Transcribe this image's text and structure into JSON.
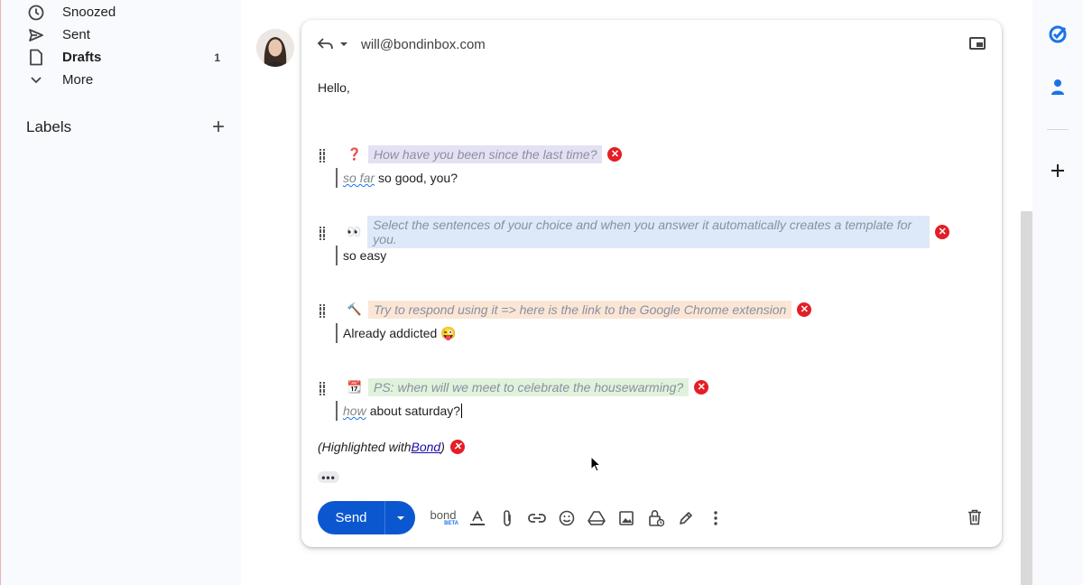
{
  "sidebar": {
    "items": [
      {
        "label": "Snoozed",
        "icon": "clock-icon",
        "count": ""
      },
      {
        "label": "Sent",
        "icon": "send-icon",
        "count": ""
      },
      {
        "label": "Drafts",
        "icon": "draft-icon",
        "count": "1"
      },
      {
        "label": "More",
        "icon": "chevron-down-icon",
        "count": ""
      }
    ],
    "labels_heading": "Labels",
    "add_label": "+"
  },
  "compose": {
    "recipient": "will@bondinbox.com",
    "greeting": "Hello,",
    "qa": [
      {
        "emoji": "❓",
        "emoji_name": "question-mark-icon",
        "question": "How have you been since the last time?",
        "question_bg": "#e4e1f3",
        "hint": "so far",
        "answer": " so good, you?"
      },
      {
        "emoji": "👀",
        "emoji_name": "eyes-icon",
        "question": "Select the sentences of your choice and when you answer it automatically creates a template for you.",
        "question_bg": "#dde9f8",
        "hint": "",
        "answer": "so easy"
      },
      {
        "emoji": "🔨",
        "emoji_name": "hammer-icon",
        "question": "Try to respond using it => here is the link to the Google Chrome extension",
        "question_bg": "#fbe6d6",
        "hint": "",
        "answer": "Already addicted 😜"
      },
      {
        "emoji": "📆",
        "emoji_name": "calendar-icon",
        "question": "PS: when will we meet to celebrate the housewarming?",
        "question_bg": "#e0f2dc",
        "hint": "how",
        "answer": " about saturday?"
      }
    ],
    "footnote_prefix": "(Highlighted with ",
    "footnote_link": "Bond",
    "footnote_suffix": ")",
    "more_dots": "•••"
  },
  "toolbar": {
    "send_label": "Send",
    "bond_logo": "bond",
    "bond_beta": "BETA",
    "tools": [
      "formatting-icon",
      "attach-icon",
      "link-icon",
      "emoji-icon",
      "drive-icon",
      "photo-icon",
      "confidential-icon",
      "signature-icon",
      "more-options-icon"
    ]
  },
  "colors": {
    "send_blue": "#0b57d0",
    "remove_red": "#e41e26",
    "tasks_blue": "#1a73e8"
  }
}
